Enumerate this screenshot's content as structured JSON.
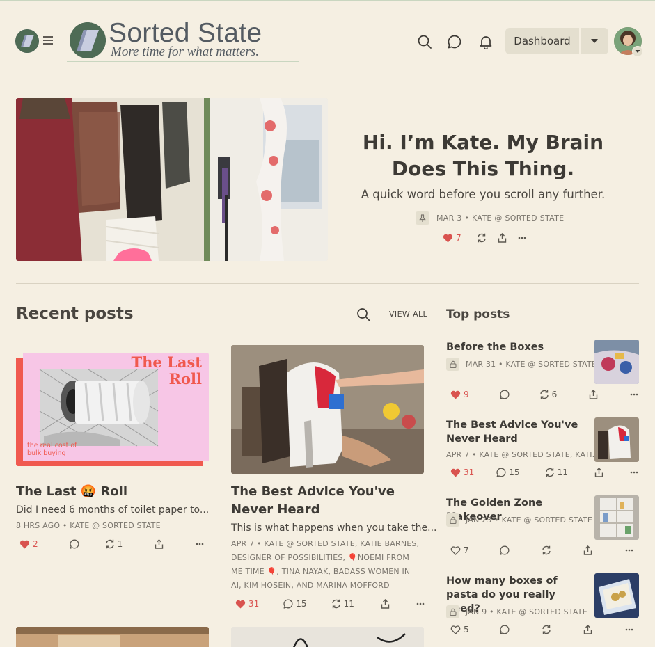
{
  "header": {
    "logo_title": "Sorted State",
    "logo_tagline": "More time for what matters.",
    "dashboard_label": "Dashboard",
    "icons": [
      "menu-icon",
      "search-icon",
      "chat-icon",
      "bell-icon",
      "chevron-down-icon"
    ]
  },
  "hero": {
    "title": "Hi. I’m Kate. My Brain Does This Thing.",
    "subtitle": "A quick word before you scroll any further.",
    "meta": "MAR 3 • KATE @ SORTED STATE",
    "likes": "7"
  },
  "sections": {
    "recent_title": "Recent posts",
    "view_all": "VIEW ALL",
    "top_title": "Top posts"
  },
  "recent_posts": [
    {
      "title": "The Last 🤬 Roll",
      "subtitle": "Did I need 6 months of toilet paper to...",
      "meta": "8 HRS AGO • KATE @ SORTED STATE",
      "likes": "2",
      "comments": "",
      "restacks": "1",
      "image_text_title": "The Last Roll",
      "image_text_sub": "the real cost of bulk buying"
    },
    {
      "title": "The Best Advice You've Never Heard",
      "subtitle": "This is what happens when you take the...",
      "meta": "APR 7 • KATE @ SORTED STATE, KATIE BARNES, DESIGNER OF POSSIBILITIES, 🎈NOEMI FROM ME TIME 🎈, TINA NAYAK, BADASS WOMEN IN AI, KIM HOSEIN, AND MARINA MOFFORD",
      "likes": "31",
      "comments": "15",
      "restacks": "11"
    }
  ],
  "top_posts": [
    {
      "title": "Before the Boxes",
      "meta": "MAR 31 • KATE @ SORTED STATE",
      "locked": true,
      "likes": "9",
      "liked": true,
      "comments": "",
      "restacks": "6"
    },
    {
      "title": "The Best Advice You've Never Heard",
      "meta": "APR 7 • KATE @ SORTED STATE, KATI...",
      "locked": false,
      "likes": "31",
      "liked": true,
      "comments": "15",
      "restacks": "11"
    },
    {
      "title": "The Golden Zone Makeover",
      "meta": "JAN 23 • KATE @ SORTED STATE",
      "locked": true,
      "likes": "7",
      "liked": false,
      "comments": "",
      "restacks": ""
    },
    {
      "title": "How many boxes of pasta do you really need?",
      "meta": "JAN 9 • KATE @ SORTED STATE",
      "locked": true,
      "likes": "5",
      "liked": false,
      "comments": "",
      "restacks": ""
    }
  ],
  "colors": {
    "background": "#f5efe2",
    "accent_red": "#d9534f",
    "button_bg": "#e4dfcf",
    "text": "#3d3a35"
  }
}
